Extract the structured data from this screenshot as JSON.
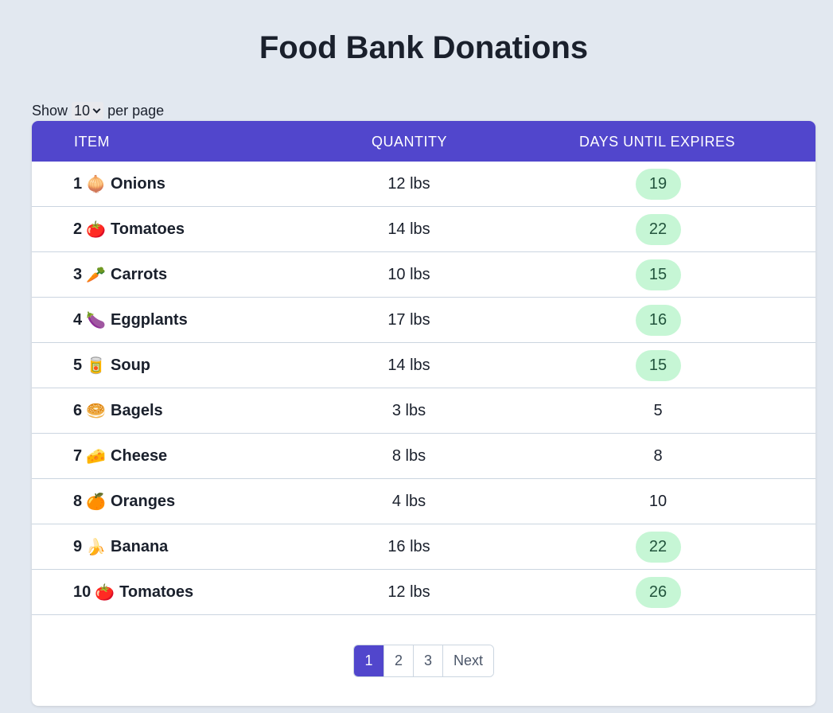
{
  "page": {
    "title": "Food Bank Donations"
  },
  "per_page": {
    "prefix": "Show",
    "selected": "10",
    "suffix": "per page"
  },
  "table": {
    "headers": [
      "ITEM",
      "QUANTITY",
      "DAYS UNTIL EXPIRES"
    ],
    "rows": [
      {
        "num": "1",
        "emoji": "🧅",
        "name": "Onions",
        "quantity": "12 lbs",
        "days": "19",
        "badge": true
      },
      {
        "num": "2",
        "emoji": "🍅",
        "name": "Tomatoes",
        "quantity": "14 lbs",
        "days": "22",
        "badge": true
      },
      {
        "num": "3",
        "emoji": "🥕",
        "name": "Carrots",
        "quantity": "10 lbs",
        "days": "15",
        "badge": true
      },
      {
        "num": "4",
        "emoji": "🍆",
        "name": "Eggplants",
        "quantity": "17 lbs",
        "days": "16",
        "badge": true
      },
      {
        "num": "5",
        "emoji": "🥫",
        "name": "Soup",
        "quantity": "14 lbs",
        "days": "15",
        "badge": true
      },
      {
        "num": "6",
        "emoji": "🥯",
        "name": "Bagels",
        "quantity": "3 lbs",
        "days": "5",
        "badge": false
      },
      {
        "num": "7",
        "emoji": "🧀",
        "name": "Cheese",
        "quantity": "8 lbs",
        "days": "8",
        "badge": false
      },
      {
        "num": "8",
        "emoji": "🍊",
        "name": "Oranges",
        "quantity": "4 lbs",
        "days": "10",
        "badge": false
      },
      {
        "num": "9",
        "emoji": "🍌",
        "name": "Banana",
        "quantity": "16 lbs",
        "days": "22",
        "badge": true
      },
      {
        "num": "10",
        "emoji": "🍅",
        "name": "Tomatoes",
        "quantity": "12 lbs",
        "days": "26",
        "badge": true
      }
    ]
  },
  "pagination": {
    "pages": [
      "1",
      "2",
      "3"
    ],
    "active": "1",
    "next_label": "Next"
  },
  "colors": {
    "background": "#e2e8f0",
    "header": "#5146cc",
    "badge_bg": "#c6f6d5",
    "badge_text": "#22543d"
  }
}
